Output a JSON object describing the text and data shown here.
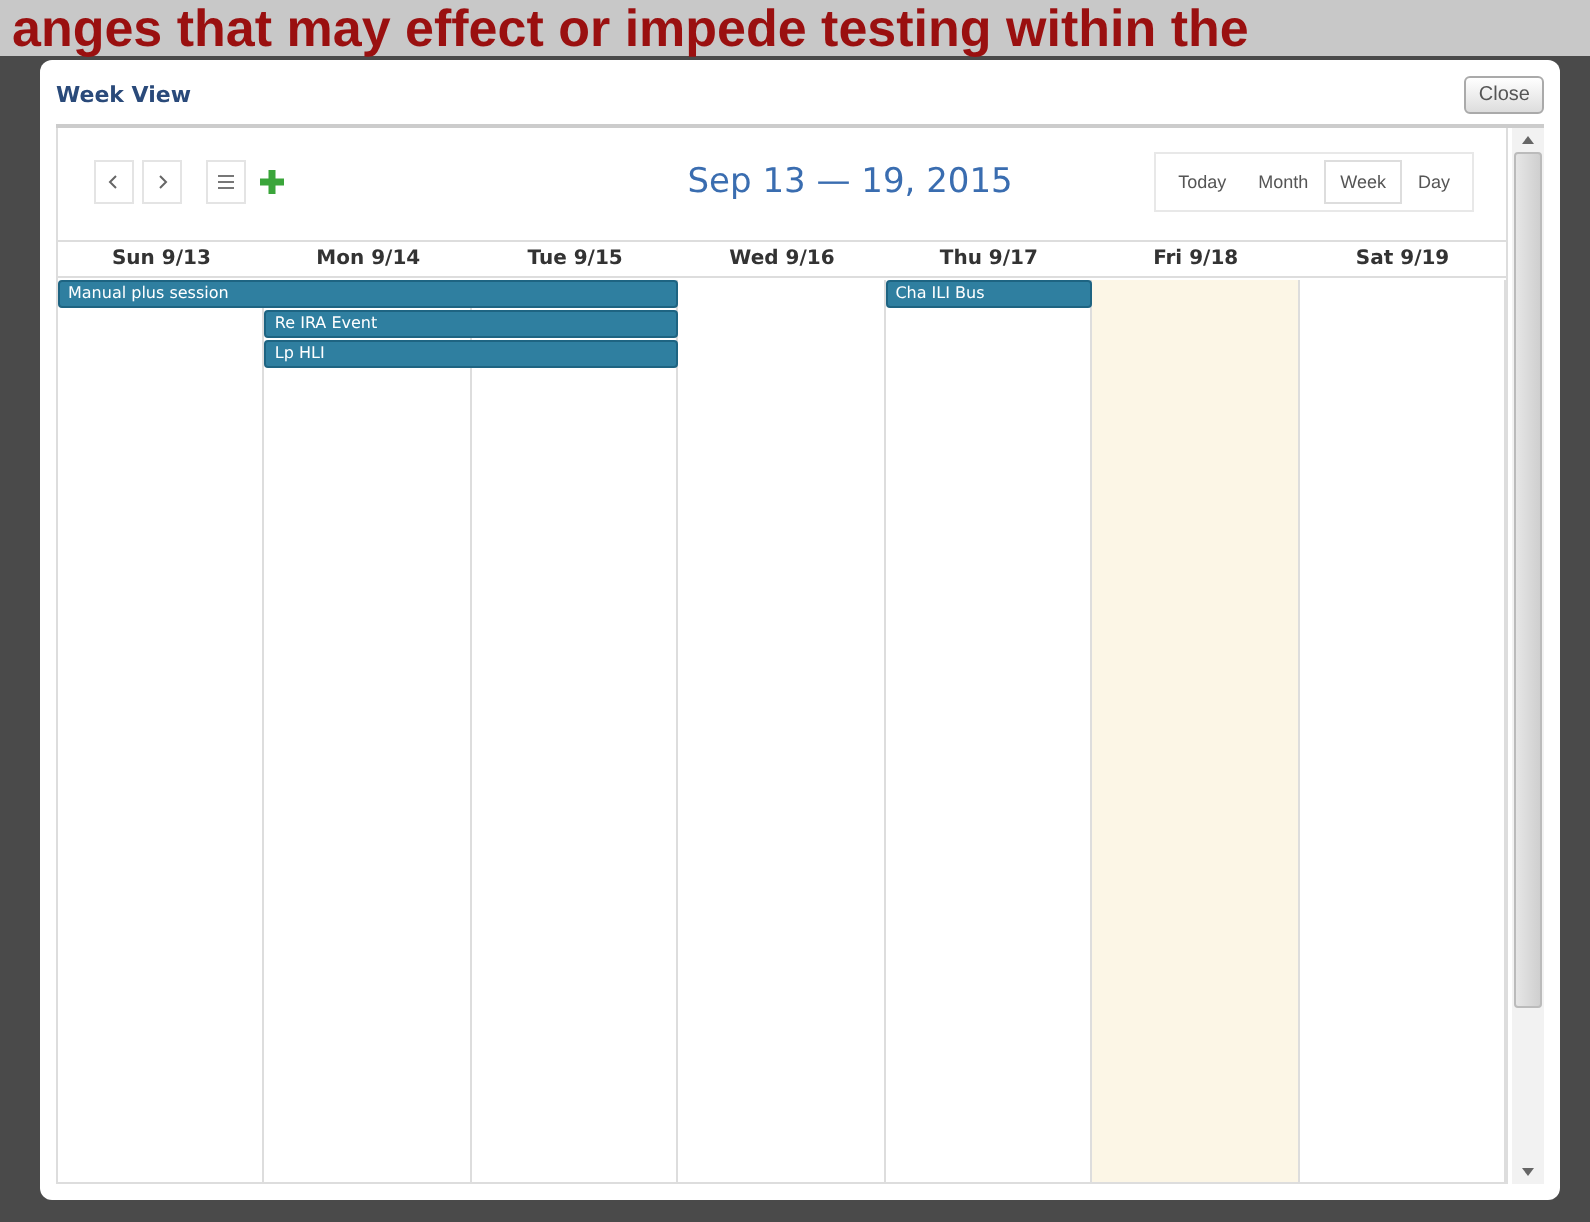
{
  "background": {
    "banner_text": "anges that may effect or impede testing within the"
  },
  "dialog": {
    "title": "Week View",
    "close_label": "Close"
  },
  "toolbar": {
    "range_title": "Sep 13 — 19, 2015",
    "views": [
      {
        "label": "Today",
        "selected": false
      },
      {
        "label": "Month",
        "selected": false
      },
      {
        "label": "Week",
        "selected": true
      },
      {
        "label": "Day",
        "selected": false
      }
    ]
  },
  "calendar": {
    "days": [
      {
        "label": "Sun 9/13",
        "today": false
      },
      {
        "label": "Mon 9/14",
        "today": false
      },
      {
        "label": "Tue 9/15",
        "today": false
      },
      {
        "label": "Wed 9/16",
        "today": false
      },
      {
        "label": "Thu 9/17",
        "today": false
      },
      {
        "label": "Fri 9/18",
        "today": true
      },
      {
        "label": "Sat 9/19",
        "today": false
      }
    ],
    "events": [
      {
        "title": "Manual plus session"
      },
      {
        "title": "Re IRA Event"
      },
      {
        "title": "Lp HLI"
      },
      {
        "title": "Cha ILI Bus"
      }
    ]
  }
}
